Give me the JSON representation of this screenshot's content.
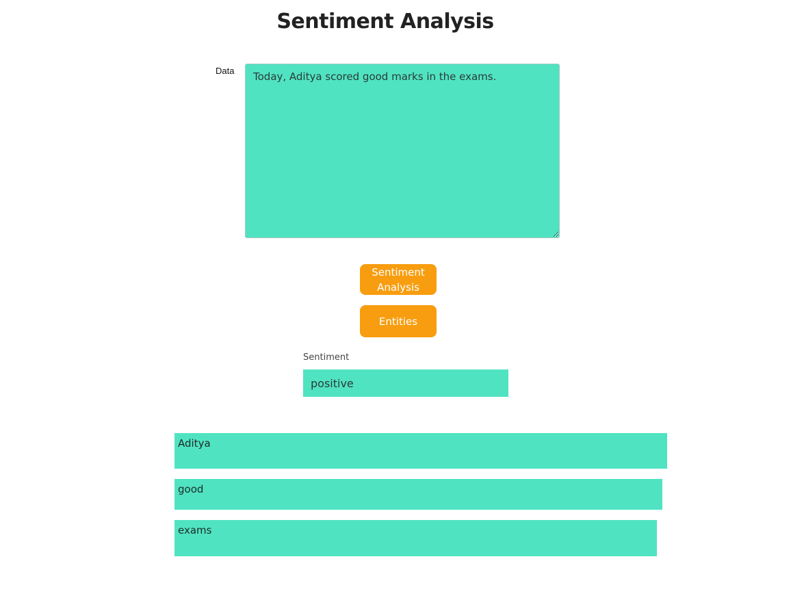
{
  "page": {
    "title": "Sentiment Analysis"
  },
  "form": {
    "data_label": "Data",
    "data_value": "Today, Aditya scored good marks in the exams."
  },
  "buttons": {
    "sentiment_label": "Sentiment Analysis",
    "entities_label": "Entities"
  },
  "result": {
    "sentiment_label": "Sentiment",
    "sentiment_value": "positive"
  },
  "entities": [
    "Aditya",
    "good",
    "exams"
  ],
  "colors": {
    "accent": "#50e3c2",
    "button": "#f79d0f"
  }
}
